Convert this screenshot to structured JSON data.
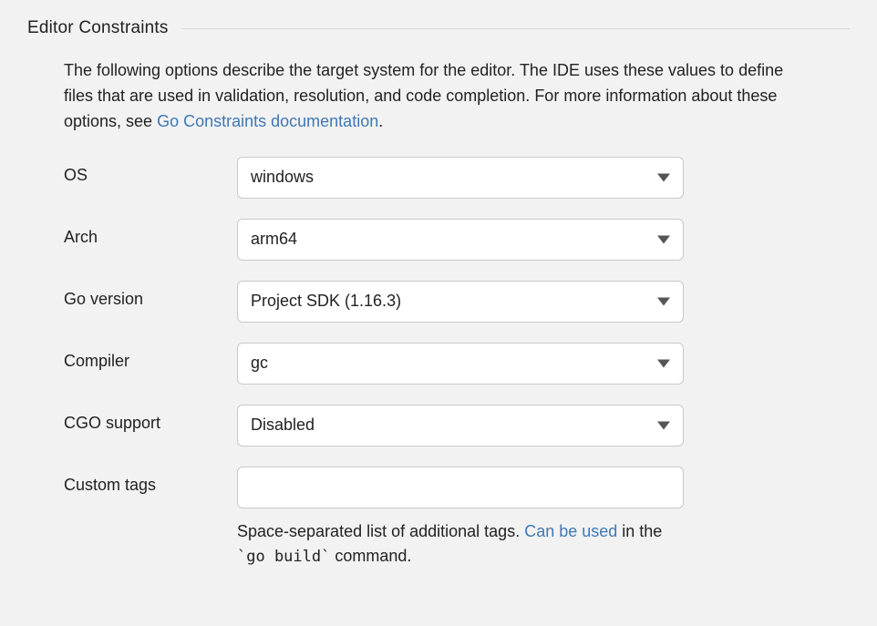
{
  "section": {
    "title": "Editor Constraints",
    "description_pre": "The following options describe the target system for the editor. The IDE uses these values to define files that are used in validation, resolution, and code completion. For more information about these options, see ",
    "description_link": "Go Constraints documentation",
    "description_post": "."
  },
  "fields": {
    "os": {
      "label": "OS",
      "value": "windows"
    },
    "arch": {
      "label": "Arch",
      "value": "arm64"
    },
    "go_version": {
      "label": "Go version",
      "value": "Project SDK (1.16.3)"
    },
    "compiler": {
      "label": "Compiler",
      "value": "gc"
    },
    "cgo": {
      "label": "CGO support",
      "value": "Disabled"
    },
    "custom_tags": {
      "label": "Custom tags",
      "value": ""
    }
  },
  "hint": {
    "pre": "Space-separated list of additional tags. ",
    "link": "Can be used",
    "post": " in the ",
    "code": "`go build`",
    "tail": " command."
  }
}
